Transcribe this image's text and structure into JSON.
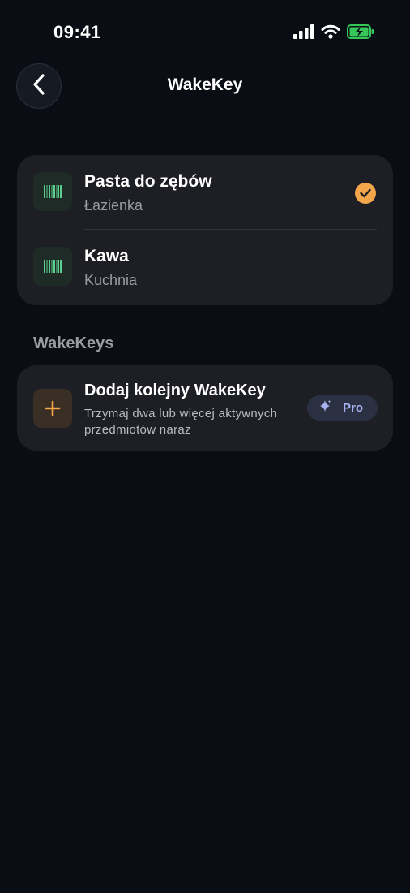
{
  "status_bar": {
    "time": "09:41"
  },
  "header": {
    "title": "WakeKey"
  },
  "items": [
    {
      "name": "Pasta do zębów",
      "room": "Łazienka",
      "selected": true
    },
    {
      "name": "Kawa",
      "room": "Kuchnia",
      "selected": false
    }
  ],
  "section": {
    "title": "WakeKeys"
  },
  "add_card": {
    "title": "Dodaj kolejny WakeKey",
    "description": "Trzymaj dwa lub więcej aktywnych przedmiotów naraz",
    "badge_label": "Pro"
  },
  "icons": {
    "back": "chevron-left-icon",
    "item": "barcode-icon",
    "selected": "checkmark-icon",
    "add": "plus-icon",
    "pro": "sparkle-icon"
  },
  "colors": {
    "background": "#0a0d14",
    "card": "#1e1f24",
    "accent_orange": "#f3a64a",
    "barcode_green": "#5ccf8f",
    "pro_text": "#a8b2f0",
    "battery_green": "#35c759"
  }
}
